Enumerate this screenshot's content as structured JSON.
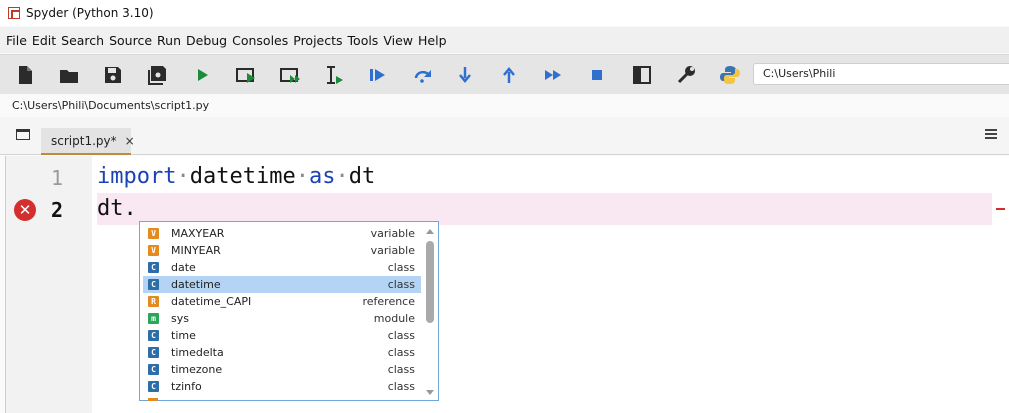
{
  "window": {
    "title": "Spyder (Python 3.10)"
  },
  "menu": [
    "File",
    "Edit",
    "Search",
    "Source",
    "Run",
    "Debug",
    "Consoles",
    "Projects",
    "Tools",
    "View",
    "Help"
  ],
  "toolbar": {
    "buttons": [
      "new-file",
      "open-file",
      "save",
      "save-all",
      "run",
      "run-cell",
      "run-cell-advance",
      "run-selection",
      "debug",
      "step",
      "step-into",
      "step-return",
      "continue",
      "stop",
      "maximize-pane",
      "preferences",
      "python-path-manager"
    ],
    "working_dir": "C:\\Users\\Phili"
  },
  "editor": {
    "file_path": "C:\\Users\\Phili\\Documents\\script1.py",
    "tab_label": "script1.py*",
    "tab_close": "×",
    "lines": [
      {
        "num": "1",
        "tokens": [
          "import",
          "datetime",
          "as",
          "dt"
        ]
      },
      {
        "num": "2",
        "text": "dt."
      }
    ],
    "error_icon": "✕"
  },
  "completion": {
    "items": [
      {
        "badge": "V",
        "name": "MAXYEAR",
        "kind": "variable"
      },
      {
        "badge": "V",
        "name": "MINYEAR",
        "kind": "variable"
      },
      {
        "badge": "C",
        "name": "date",
        "kind": "class"
      },
      {
        "badge": "C",
        "name": "datetime",
        "kind": "class",
        "selected": true
      },
      {
        "badge": "R",
        "name": "datetime_CAPI",
        "kind": "reference"
      },
      {
        "badge": "m",
        "name": "sys",
        "kind": "module"
      },
      {
        "badge": "C",
        "name": "time",
        "kind": "class"
      },
      {
        "badge": "C",
        "name": "timedelta",
        "kind": "class"
      },
      {
        "badge": "C",
        "name": "timezone",
        "kind": "class"
      },
      {
        "badge": "C",
        "name": "tzinfo",
        "kind": "class"
      }
    ]
  }
}
